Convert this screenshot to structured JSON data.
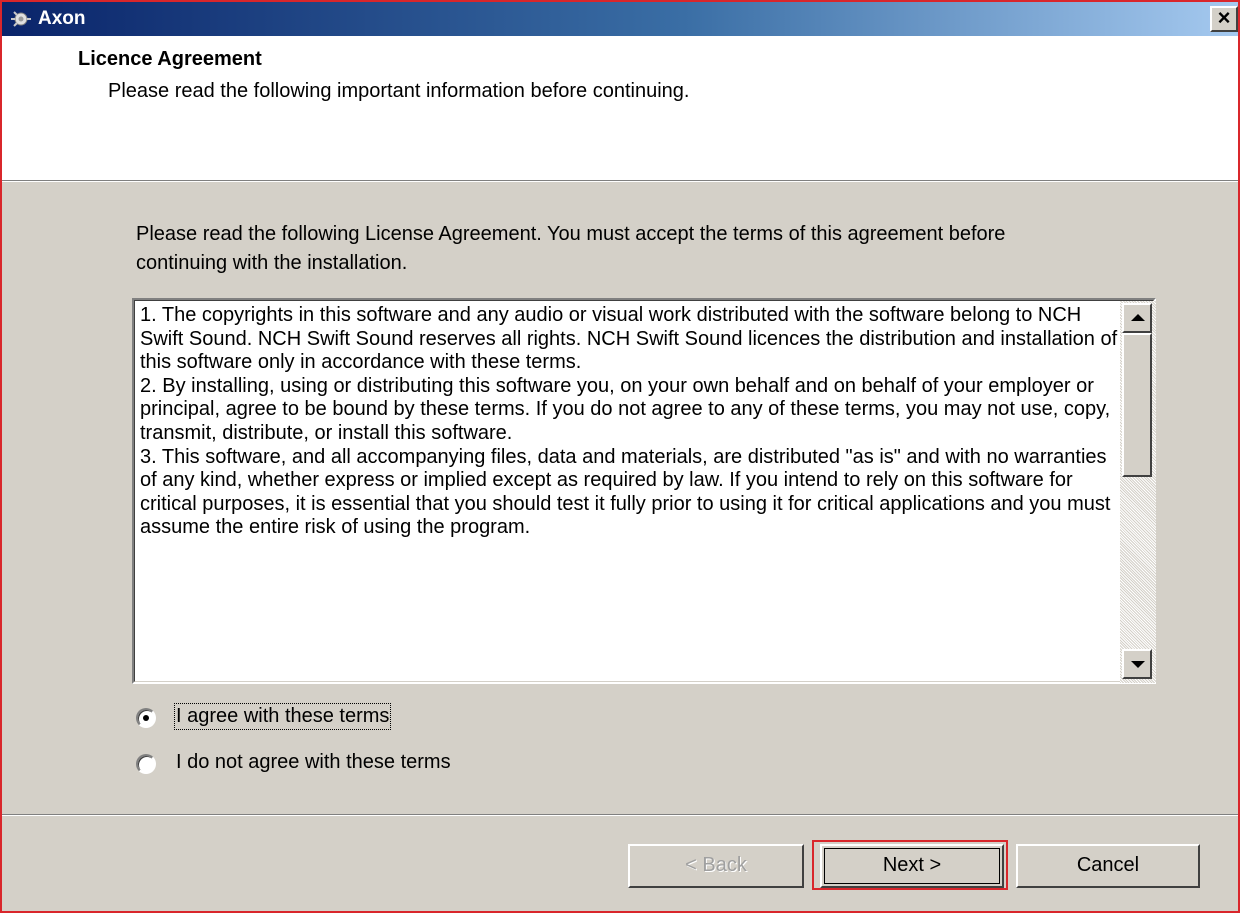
{
  "window": {
    "title": "Axon",
    "close_glyph": "×"
  },
  "header": {
    "title": "Licence Agreement",
    "subtitle": "Please read the following important information before continuing."
  },
  "main": {
    "intro": "Please read the following License Agreement. You must accept the terms of this agreement before continuing with the installation.",
    "license_paragraphs": [
      "1. The copyrights in this software and any audio or visual work distributed with the software belong to NCH Swift Sound. NCH Swift Sound reserves all rights. NCH Swift Sound licences the distribution and installation of this software only in accordance with these terms.",
      "2. By installing, using or distributing this software you, on your own behalf and on behalf of your employer or principal, agree to be bound by these terms. If you do not agree to any of these terms, you may not use, copy, transmit, distribute, or install this software.",
      "3. This software, and all accompanying files, data and materials, are distributed \"as is\" and with no warranties of any kind, whether express or implied except as required by law. If you intend to rely on this software for critical purposes, it is essential that you should test it fully prior to using it for critical applications and you must assume the entire risk of using the program."
    ],
    "radio_agree": {
      "label": "I agree with these terms",
      "selected": true
    },
    "radio_disagree": {
      "label": "I do not agree with these terms",
      "selected": false
    }
  },
  "footer": {
    "back_label": "< Back",
    "next_label": "Next >",
    "cancel_label": "Cancel"
  },
  "colors": {
    "titlebar_start": "#0a246a",
    "titlebar_end": "#a6caf0",
    "highlight_border": "#d9262b",
    "dialog_face": "#d4d0c8"
  },
  "icons": [
    "app-icon",
    "close-icon",
    "scroll-up-arrow-icon",
    "scroll-down-arrow-icon"
  ]
}
